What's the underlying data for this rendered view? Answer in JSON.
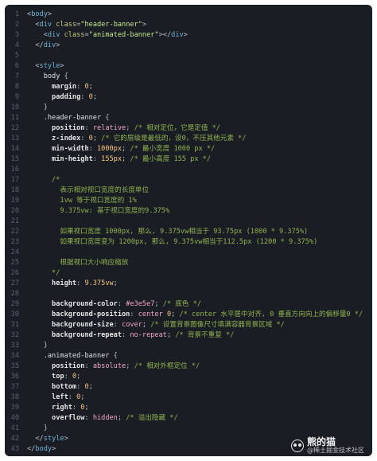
{
  "code_lines": [
    {
      "n": "1",
      "parts": [
        {
          "t": "<",
          "c": "punc"
        },
        {
          "t": "body",
          "c": "tag"
        },
        {
          "t": ">",
          "c": "punc"
        }
      ]
    },
    {
      "n": "2",
      "parts": [
        {
          "t": "  ",
          "c": "punc"
        },
        {
          "t": "<",
          "c": "punc"
        },
        {
          "t": "div ",
          "c": "tag"
        },
        {
          "t": "class",
          "c": "attr"
        },
        {
          "t": "=",
          "c": "punc"
        },
        {
          "t": "\"header-banner\"",
          "c": "str"
        },
        {
          "t": ">",
          "c": "punc"
        }
      ]
    },
    {
      "n": "3",
      "parts": [
        {
          "t": "    ",
          "c": "punc"
        },
        {
          "t": "<",
          "c": "punc"
        },
        {
          "t": "div ",
          "c": "tag"
        },
        {
          "t": "class",
          "c": "attr"
        },
        {
          "t": "=",
          "c": "punc"
        },
        {
          "t": "\"animated-banner\"",
          "c": "str"
        },
        {
          "t": "></",
          "c": "punc"
        },
        {
          "t": "div",
          "c": "tag"
        },
        {
          "t": ">",
          "c": "punc"
        }
      ]
    },
    {
      "n": "4",
      "parts": [
        {
          "t": "  ",
          "c": "punc"
        },
        {
          "t": "</",
          "c": "punc"
        },
        {
          "t": "div",
          "c": "tag"
        },
        {
          "t": ">",
          "c": "punc"
        }
      ]
    },
    {
      "n": "5",
      "parts": []
    },
    {
      "n": "6",
      "parts": [
        {
          "t": "  ",
          "c": "punc"
        },
        {
          "t": "<",
          "c": "punc"
        },
        {
          "t": "style",
          "c": "tag"
        },
        {
          "t": ">",
          "c": "punc"
        }
      ]
    },
    {
      "n": "7",
      "parts": [
        {
          "t": "    ",
          "c": "punc"
        },
        {
          "t": "body ",
          "c": "sel"
        },
        {
          "t": "{",
          "c": "punc"
        }
      ]
    },
    {
      "n": "8",
      "parts": [
        {
          "t": "      ",
          "c": "punc"
        },
        {
          "t": "margin",
          "c": "prop"
        },
        {
          "t": ": ",
          "c": "punc"
        },
        {
          "t": "0",
          "c": "num"
        },
        {
          "t": ";",
          "c": "punc"
        }
      ]
    },
    {
      "n": "9",
      "parts": [
        {
          "t": "      ",
          "c": "punc"
        },
        {
          "t": "padding",
          "c": "prop"
        },
        {
          "t": ": ",
          "c": "punc"
        },
        {
          "t": "0",
          "c": "num"
        },
        {
          "t": ";",
          "c": "punc"
        }
      ]
    },
    {
      "n": "10",
      "parts": [
        {
          "t": "    ",
          "c": "punc"
        },
        {
          "t": "}",
          "c": "punc"
        }
      ]
    },
    {
      "n": "11",
      "parts": [
        {
          "t": "    ",
          "c": "punc"
        },
        {
          "t": ".header-banner ",
          "c": "sel"
        },
        {
          "t": "{",
          "c": "punc"
        }
      ]
    },
    {
      "n": "12",
      "parts": [
        {
          "t": "      ",
          "c": "punc"
        },
        {
          "t": "position",
          "c": "prop"
        },
        {
          "t": ": ",
          "c": "punc"
        },
        {
          "t": "relative",
          "c": "val"
        },
        {
          "t": "; ",
          "c": "punc"
        },
        {
          "t": "/* 相对定位，它是定值 */",
          "c": "cm"
        }
      ]
    },
    {
      "n": "13",
      "parts": [
        {
          "t": "      ",
          "c": "punc"
        },
        {
          "t": "z-index",
          "c": "prop"
        },
        {
          "t": ": ",
          "c": "punc"
        },
        {
          "t": "0",
          "c": "num"
        },
        {
          "t": "; ",
          "c": "punc"
        },
        {
          "t": "/* 它的层级是最低的，设0，不压其他元素 */",
          "c": "cm"
        }
      ]
    },
    {
      "n": "14",
      "parts": [
        {
          "t": "      ",
          "c": "punc"
        },
        {
          "t": "min-width",
          "c": "prop"
        },
        {
          "t": ": ",
          "c": "punc"
        },
        {
          "t": "1000px",
          "c": "num"
        },
        {
          "t": "; ",
          "c": "punc"
        },
        {
          "t": "/* 最小宽度 1000 px */",
          "c": "cm"
        }
      ]
    },
    {
      "n": "15",
      "parts": [
        {
          "t": "      ",
          "c": "punc"
        },
        {
          "t": "min-height",
          "c": "prop"
        },
        {
          "t": ": ",
          "c": "punc"
        },
        {
          "t": "155px",
          "c": "num"
        },
        {
          "t": "; ",
          "c": "punc"
        },
        {
          "t": "/* 最小高度 155 px */",
          "c": "cm"
        }
      ]
    },
    {
      "n": "16",
      "parts": []
    },
    {
      "n": "17",
      "parts": [
        {
          "t": "      /*",
          "c": "cm"
        }
      ]
    },
    {
      "n": "18",
      "parts": [
        {
          "t": "        表示相对视口宽度的长度单位",
          "c": "cm"
        }
      ]
    },
    {
      "n": "19",
      "parts": [
        {
          "t": "        1vw 等于视口宽度的 1%",
          "c": "cm"
        }
      ]
    },
    {
      "n": "20",
      "parts": [
        {
          "t": "        9.375vw: 基于视口宽度的9.375%",
          "c": "cm"
        }
      ]
    },
    {
      "n": "21",
      "parts": []
    },
    {
      "n": "22",
      "parts": [
        {
          "t": "        如果视口宽度 1000px, 那么, 9.375vw相当于 93.75px (1000 * 9.375%)",
          "c": "cm"
        }
      ]
    },
    {
      "n": "23",
      "parts": [
        {
          "t": "        如果视口宽度变为 1200px, 那么, 9.375vw相当于112.5px (1200 * 9.375%)",
          "c": "cm"
        }
      ]
    },
    {
      "n": "24",
      "parts": []
    },
    {
      "n": "25",
      "parts": [
        {
          "t": "        根据视口大小响应缩放",
          "c": "cm"
        }
      ]
    },
    {
      "n": "26",
      "parts": [
        {
          "t": "      */",
          "c": "cm"
        }
      ]
    },
    {
      "n": "27",
      "parts": [
        {
          "t": "      ",
          "c": "punc"
        },
        {
          "t": "height",
          "c": "prop"
        },
        {
          "t": ": ",
          "c": "punc"
        },
        {
          "t": "9.375vw",
          "c": "num"
        },
        {
          "t": ";",
          "c": "punc"
        }
      ]
    },
    {
      "n": "28",
      "parts": []
    },
    {
      "n": "29",
      "parts": [
        {
          "t": "      ",
          "c": "punc"
        },
        {
          "t": "background-color",
          "c": "prop"
        },
        {
          "t": ": ",
          "c": "punc"
        },
        {
          "t": "#e3e5e7",
          "c": "val"
        },
        {
          "t": "; ",
          "c": "punc"
        },
        {
          "t": "/* 底色 */",
          "c": "cm"
        }
      ]
    },
    {
      "n": "30",
      "parts": [
        {
          "t": "      ",
          "c": "punc"
        },
        {
          "t": "background-position",
          "c": "prop"
        },
        {
          "t": ": ",
          "c": "punc"
        },
        {
          "t": "center ",
          "c": "val"
        },
        {
          "t": "0",
          "c": "num"
        },
        {
          "t": "; ",
          "c": "punc"
        },
        {
          "t": "/* center 水平居中对齐, 0 垂直方向向上的偏移量0 */",
          "c": "cm"
        }
      ]
    },
    {
      "n": "31",
      "parts": [
        {
          "t": "      ",
          "c": "punc"
        },
        {
          "t": "background-size",
          "c": "prop"
        },
        {
          "t": ": ",
          "c": "punc"
        },
        {
          "t": "cover",
          "c": "val"
        },
        {
          "t": "; ",
          "c": "punc"
        },
        {
          "t": "/* 设置背景图像尺寸填满容器背景区域 */",
          "c": "cm"
        }
      ]
    },
    {
      "n": "32",
      "parts": [
        {
          "t": "      ",
          "c": "punc"
        },
        {
          "t": "background-repeat",
          "c": "prop"
        },
        {
          "t": ": ",
          "c": "punc"
        },
        {
          "t": "no-repeat",
          "c": "val"
        },
        {
          "t": "; ",
          "c": "punc"
        },
        {
          "t": "/* 背景不重复 */",
          "c": "cm"
        }
      ]
    },
    {
      "n": "33",
      "parts": [
        {
          "t": "    ",
          "c": "punc"
        },
        {
          "t": "}",
          "c": "punc"
        }
      ]
    },
    {
      "n": "34",
      "parts": [
        {
          "t": "    ",
          "c": "punc"
        },
        {
          "t": ".animated-banner ",
          "c": "sel"
        },
        {
          "t": "{",
          "c": "punc"
        }
      ]
    },
    {
      "n": "35",
      "parts": [
        {
          "t": "      ",
          "c": "punc"
        },
        {
          "t": "position",
          "c": "prop"
        },
        {
          "t": ": ",
          "c": "punc"
        },
        {
          "t": "absolute",
          "c": "val"
        },
        {
          "t": "; ",
          "c": "punc"
        },
        {
          "t": "/* 相对外框定位 */",
          "c": "cm"
        }
      ]
    },
    {
      "n": "36",
      "parts": [
        {
          "t": "      ",
          "c": "punc"
        },
        {
          "t": "top",
          "c": "prop"
        },
        {
          "t": ": ",
          "c": "punc"
        },
        {
          "t": "0",
          "c": "num"
        },
        {
          "t": ";",
          "c": "punc"
        }
      ]
    },
    {
      "n": "37",
      "parts": [
        {
          "t": "      ",
          "c": "punc"
        },
        {
          "t": "bottom",
          "c": "prop"
        },
        {
          "t": ": ",
          "c": "punc"
        },
        {
          "t": "0",
          "c": "num"
        },
        {
          "t": ";",
          "c": "punc"
        }
      ]
    },
    {
      "n": "38",
      "parts": [
        {
          "t": "      ",
          "c": "punc"
        },
        {
          "t": "left",
          "c": "prop"
        },
        {
          "t": ": ",
          "c": "punc"
        },
        {
          "t": "0",
          "c": "num"
        },
        {
          "t": ";",
          "c": "punc"
        }
      ]
    },
    {
      "n": "39",
      "parts": [
        {
          "t": "      ",
          "c": "punc"
        },
        {
          "t": "right",
          "c": "prop"
        },
        {
          "t": ": ",
          "c": "punc"
        },
        {
          "t": "0",
          "c": "num"
        },
        {
          "t": ";",
          "c": "punc"
        }
      ]
    },
    {
      "n": "40",
      "parts": [
        {
          "t": "      ",
          "c": "punc"
        },
        {
          "t": "overflow",
          "c": "prop"
        },
        {
          "t": ": ",
          "c": "punc"
        },
        {
          "t": "hidden",
          "c": "val"
        },
        {
          "t": "; ",
          "c": "punc"
        },
        {
          "t": "/* 溢出隐藏 */",
          "c": "cm"
        }
      ]
    },
    {
      "n": "41",
      "parts": [
        {
          "t": "    ",
          "c": "punc"
        },
        {
          "t": "}",
          "c": "punc"
        }
      ]
    },
    {
      "n": "42",
      "parts": [
        {
          "t": "  ",
          "c": "punc"
        },
        {
          "t": "</",
          "c": "punc"
        },
        {
          "t": "style",
          "c": "tag"
        },
        {
          "t": ">",
          "c": "punc"
        }
      ]
    },
    {
      "n": "43",
      "parts": [
        {
          "t": "</",
          "c": "punc"
        },
        {
          "t": "body",
          "c": "tag"
        },
        {
          "t": ">",
          "c": "punc"
        }
      ]
    }
  ],
  "watermark": {
    "icon": "wechat-icon",
    "title": "熊的猫",
    "subtitle": "@稀土掘金技术社区"
  }
}
